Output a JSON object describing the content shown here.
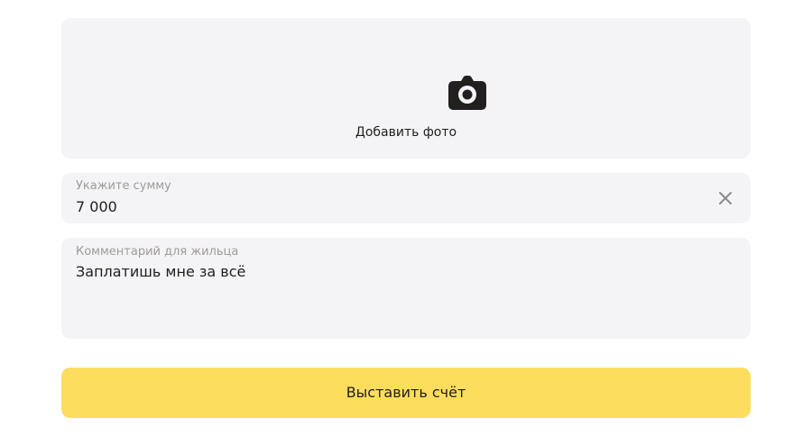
{
  "photo_upload": {
    "label": "Добавить фото",
    "icon": "camera-icon"
  },
  "amount": {
    "label": "Укажите сумму",
    "value": "7 000",
    "clear_icon": "close-icon"
  },
  "comment": {
    "label": "Комментарий для жильца",
    "value": "Заплатишь мне за всё"
  },
  "submit": {
    "label": "Выставить счёт"
  },
  "colors": {
    "field_background": "#f4f4f6",
    "button_background": "#fddd5d",
    "text": "#21201f",
    "label_text": "#9e9b98"
  }
}
